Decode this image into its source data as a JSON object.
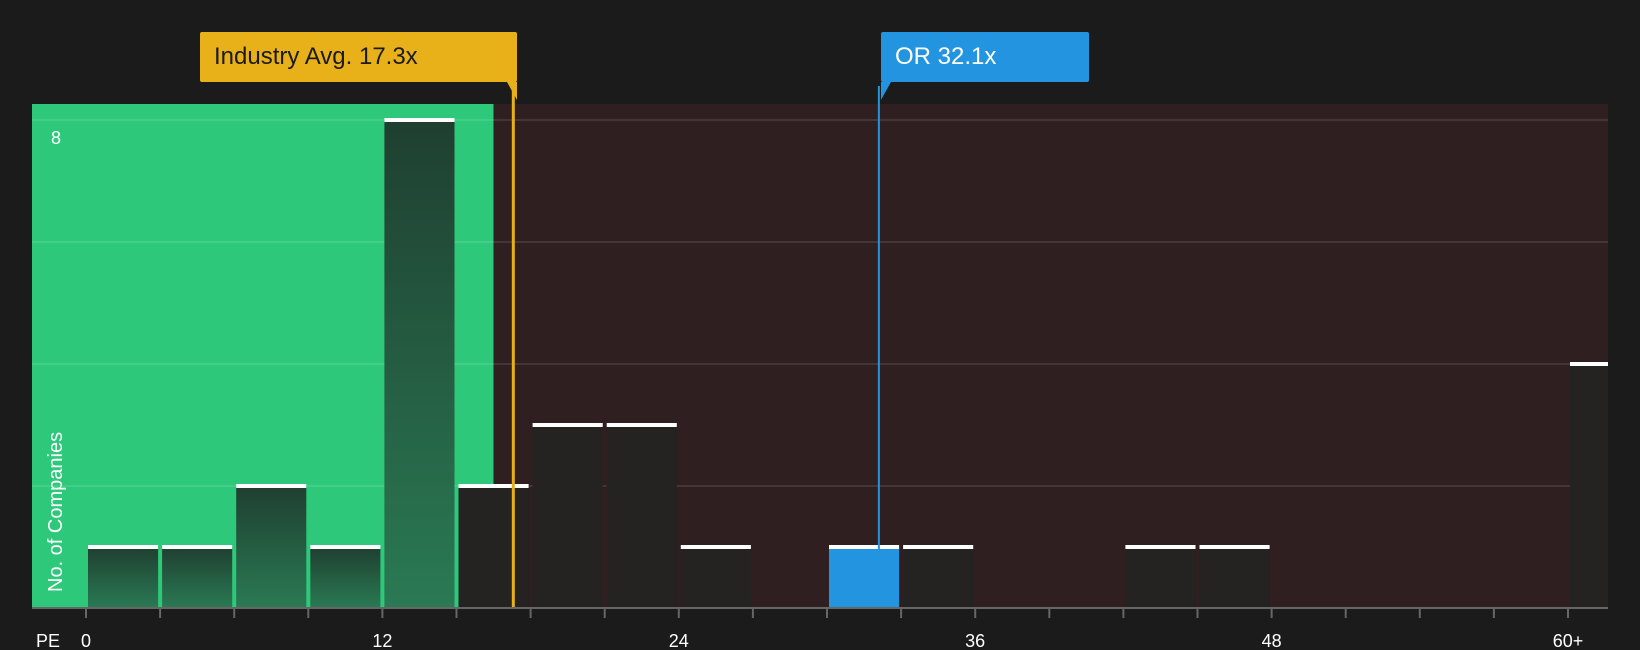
{
  "chart_data": {
    "type": "bar",
    "x_axis_label": "PE",
    "y_axis_label": "No. of Companies",
    "x_ticks": [
      "0",
      "12",
      "24",
      "36",
      "48",
      "60+"
    ],
    "y_ticks": [
      "8"
    ],
    "bin_width": 3,
    "bins": [
      {
        "from": 0,
        "to": 3,
        "count": 1
      },
      {
        "from": 3,
        "to": 6,
        "count": 1
      },
      {
        "from": 6,
        "to": 9,
        "count": 2
      },
      {
        "from": 9,
        "to": 12,
        "count": 1
      },
      {
        "from": 12,
        "to": 15,
        "count": 8
      },
      {
        "from": 15,
        "to": 18,
        "count": 2
      },
      {
        "from": 18,
        "to": 21,
        "count": 3
      },
      {
        "from": 21,
        "to": 24,
        "count": 3
      },
      {
        "from": 24,
        "to": 27,
        "count": 1
      },
      {
        "from": 30,
        "to": 33,
        "count": 1,
        "highlight": true
      },
      {
        "from": 33,
        "to": 36,
        "count": 1
      },
      {
        "from": 42,
        "to": 45,
        "count": 1
      },
      {
        "from": 45,
        "to": 48,
        "count": 1
      },
      {
        "from": 60,
        "to": 63,
        "count": 4
      }
    ],
    "ylim": [
      0,
      8
    ],
    "xlim": [
      -2.2,
      61.5
    ],
    "grid": true,
    "fair_zone_end": 16.5,
    "markers": [
      {
        "name": "industry",
        "label": "Industry Avg. 17.3x",
        "value": 17.3,
        "color": "#e8b11a"
      },
      {
        "name": "company",
        "label": "OR 32.1x",
        "value": 32.1,
        "color": "#2394e0"
      }
    ],
    "colors": {
      "background": "#1b1b1b",
      "fair_zone": "#2dc87a",
      "expensive_zone": "#2f1f20",
      "bar_dark": "#252222",
      "bar_highlight": "#2394e0",
      "bar_cap": "#ffffff",
      "axis_text": "#ffffff"
    }
  }
}
